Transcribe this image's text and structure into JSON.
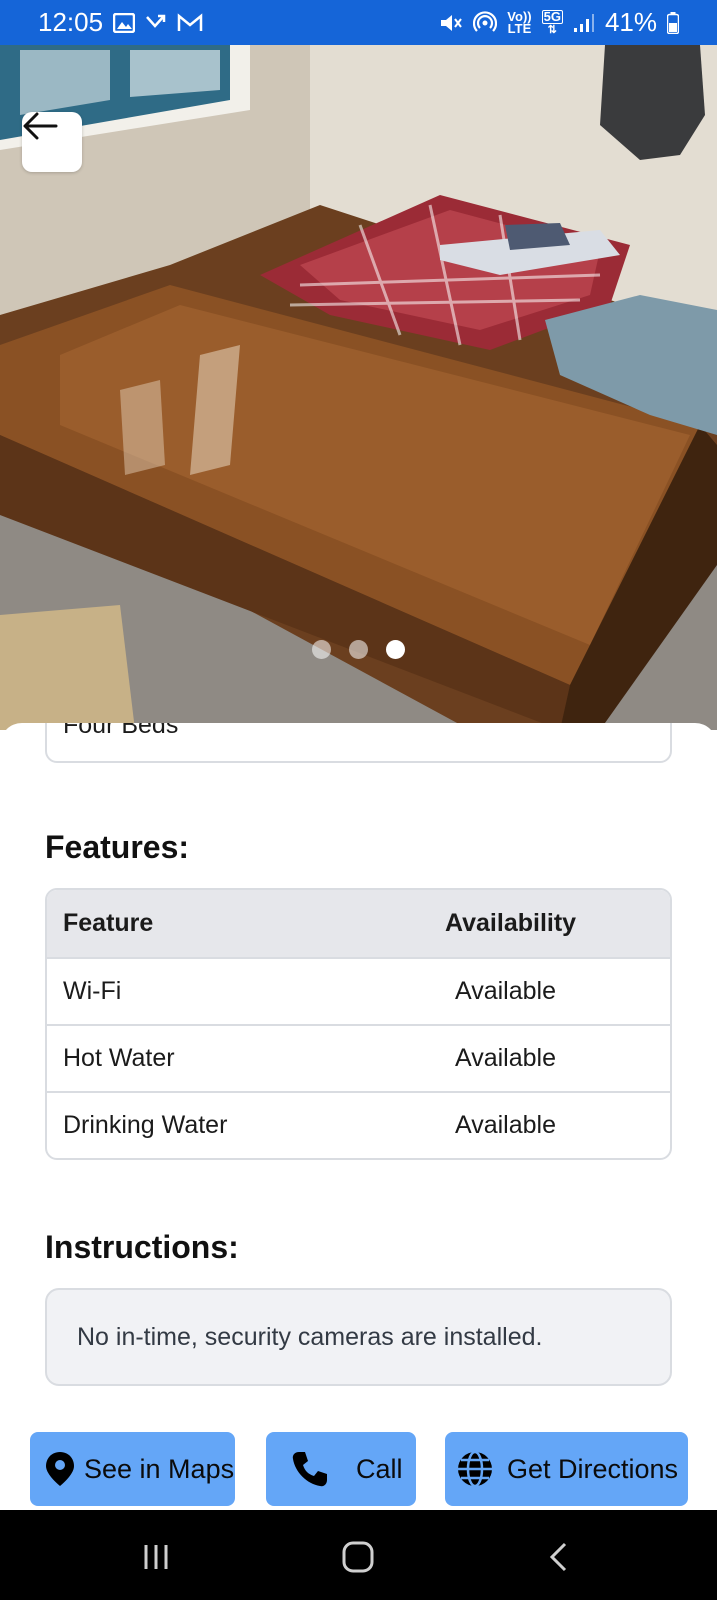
{
  "status_bar": {
    "time": "12:05",
    "battery": "41%",
    "network": "5G",
    "volte_top": "Vo))",
    "volte_bottom": "LTE"
  },
  "hero": {
    "back_button": "back",
    "carousel": {
      "count": 3,
      "active_index": 2
    }
  },
  "details": {
    "beds_value": "Four Beds"
  },
  "features": {
    "title": "Features:",
    "columns": [
      "Feature",
      "Availability"
    ],
    "rows": [
      [
        "Wi-Fi",
        "Available"
      ],
      [
        "Hot Water",
        "Available"
      ],
      [
        "Drinking Water",
        "Available"
      ]
    ]
  },
  "instructions": {
    "title": "Instructions:",
    "text": "No in-time, security cameras are installed."
  },
  "actions": {
    "maps_label": "See in Maps",
    "call_label": "Call",
    "directions_label": "Get Directions"
  },
  "colors": {
    "status_bar": "#1565d8",
    "action_button": "#64a6f7",
    "table_header": "#e6e7eb"
  }
}
